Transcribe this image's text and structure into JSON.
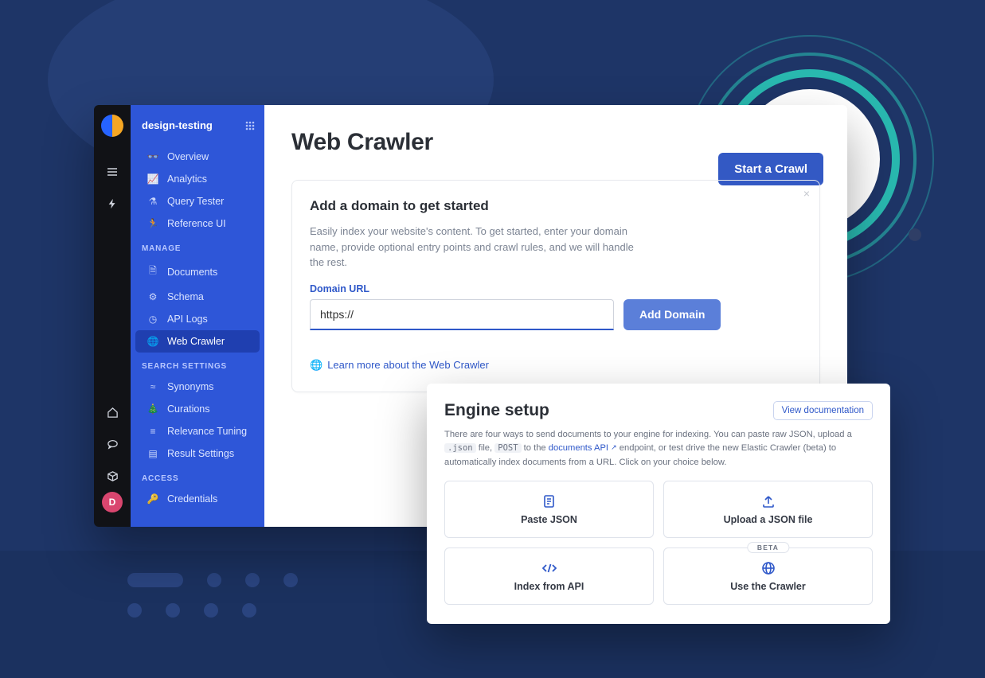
{
  "breadcrumb": {
    "title": "design-testing"
  },
  "sidebar": {
    "groups": [
      {
        "label": null,
        "items": [
          {
            "icon": "binoculars",
            "label": "Overview"
          },
          {
            "icon": "chart",
            "label": "Analytics"
          },
          {
            "icon": "flask",
            "label": "Query Tester"
          },
          {
            "icon": "run",
            "label": "Reference UI"
          }
        ]
      },
      {
        "label": "MANAGE",
        "items": [
          {
            "icon": "docs",
            "label": "Documents"
          },
          {
            "icon": "gear",
            "label": "Schema"
          },
          {
            "icon": "clock",
            "label": "API Logs"
          },
          {
            "icon": "globe",
            "label": "Web Crawler",
            "active": true
          }
        ]
      },
      {
        "label": "SEARCH SETTINGS",
        "items": [
          {
            "icon": "approx",
            "label": "Synonyms"
          },
          {
            "icon": "tree",
            "label": "Curations"
          },
          {
            "icon": "sliders",
            "label": "Relevance Tuning"
          },
          {
            "icon": "result",
            "label": "Result Settings"
          }
        ]
      },
      {
        "label": "ACCESS",
        "items": [
          {
            "icon": "key",
            "label": "Credentials"
          }
        ]
      }
    ]
  },
  "avatar": {
    "initial": "D"
  },
  "page": {
    "title": "Web Crawler",
    "start_button": "Start a Crawl"
  },
  "domain_card": {
    "heading": "Add a domain to get started",
    "description": "Easily index your website's content. To get started, enter your domain name, provide optional entry points and crawl rules, and we will handle the rest.",
    "field_label": "Domain URL",
    "input_value": "https://",
    "add_button": "Add Domain",
    "learn_link": "Learn more about the Web Crawler"
  },
  "engine": {
    "heading": "Engine setup",
    "view_doc": "View documentation",
    "desc_pre": "There are four ways to send documents to your engine for indexing. You can paste raw JSON, upload a ",
    "desc_code1": ".json",
    "desc_mid1": " file, ",
    "desc_code2": "POST",
    "desc_mid2": " to the ",
    "desc_link": "documents API",
    "desc_rest": " endpoint, or test drive the new Elastic Crawler (beta) to automatically index documents from a URL. Click on your choice below.",
    "options": [
      {
        "icon": "paste",
        "label": "Paste JSON"
      },
      {
        "icon": "upload",
        "label": "Upload a JSON file"
      },
      {
        "icon": "api",
        "label": "Index from API"
      },
      {
        "icon": "crawler",
        "label": "Use the Crawler",
        "badge": "BETA"
      }
    ]
  }
}
